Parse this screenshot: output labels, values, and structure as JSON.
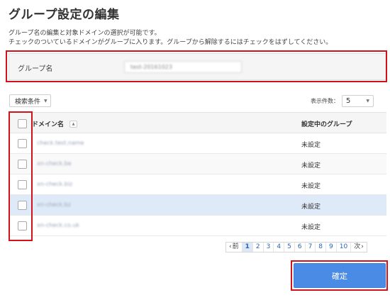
{
  "page": {
    "title": "グループ設定の編集",
    "description_line1": "グループ名の編集と対象ドメインの選択が可能です。",
    "description_line2": "チェックのついているドメインがグループに入ります。グループから解除するにはチェックをはずしてください。"
  },
  "group": {
    "label": "グループ名",
    "name_value": "test-20161023"
  },
  "toolbar": {
    "search_condition_label": "検索条件",
    "per_page_label": "表示件数：",
    "per_page_value": "5"
  },
  "table": {
    "columns": [
      "ドメイン名",
      "設定中のグループ"
    ],
    "rows": [
      {
        "domain": "check.test.name",
        "group": "未設定",
        "highlighted": false
      },
      {
        "domain": "xn-check.be",
        "group": "未設定",
        "highlighted": false
      },
      {
        "domain": "xn-check.biz",
        "group": "未設定",
        "highlighted": false
      },
      {
        "domain": "xn-check.bz",
        "group": "未設定",
        "highlighted": true
      },
      {
        "domain": "xn-check.co.uk",
        "group": "未設定",
        "highlighted": false
      }
    ]
  },
  "pagination": {
    "prev_label": "前",
    "next_label": "次",
    "pages": [
      "1",
      "2",
      "3",
      "4",
      "5",
      "6",
      "7",
      "8",
      "9",
      "10"
    ],
    "current": "1"
  },
  "actions": {
    "confirm_label": "確定"
  },
  "colors": {
    "accent": "#4a8be6",
    "highlight_frame": "#d0121b",
    "row_highlight": "#dfeaf8"
  }
}
